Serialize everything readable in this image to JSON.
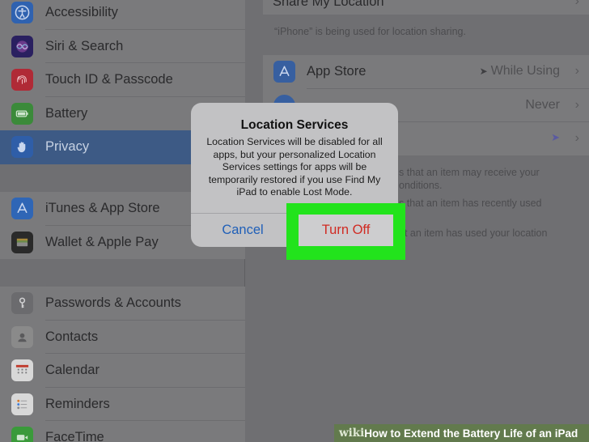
{
  "sidebar": {
    "group1": [
      {
        "label": "Accessibility",
        "icon": "accessibility-icon",
        "color": "#2f62b0"
      },
      {
        "label": "Siri & Search",
        "icon": "siri-icon",
        "color": "#2a2060"
      },
      {
        "label": "Touch ID & Passcode",
        "icon": "fingerprint-icon",
        "color": "#b02a36"
      },
      {
        "label": "Battery",
        "icon": "battery-icon",
        "color": "#3b8a3a"
      },
      {
        "label": "Privacy",
        "icon": "hand-icon",
        "color": "#2f5ea8"
      }
    ],
    "group2": [
      {
        "label": "iTunes & App Store",
        "icon": "app-store-icon",
        "color": "#2f66b6"
      },
      {
        "label": "Wallet & Apple Pay",
        "icon": "wallet-icon",
        "color": "#2a2a2a"
      }
    ],
    "group3": [
      {
        "label": "Passwords & Accounts",
        "icon": "key-icon",
        "color": "#6b6b6e"
      },
      {
        "label": "Contacts",
        "icon": "contacts-icon",
        "color": "#8a8a8a"
      },
      {
        "label": "Calendar",
        "icon": "calendar-icon",
        "color": "#d8d8d8"
      },
      {
        "label": "Reminders",
        "icon": "reminders-icon",
        "color": "#d8d8d8"
      },
      {
        "label": "FaceTime",
        "icon": "facetime-icon",
        "color": "#3a9a3a"
      }
    ],
    "selected": "Privacy"
  },
  "detail": {
    "share_location_label": "Share My Location",
    "share_note": "“iPhone” is being used for location sharing.",
    "apps": [
      {
        "label": "App Store",
        "value": "While Using",
        "icon": "app-store-icon",
        "has_arrow": true
      },
      {
        "label": "",
        "value": "Never",
        "icon": "safari-icon",
        "has_arrow": false
      },
      {
        "label": "",
        "value": "",
        "icon": "system-services-icon",
        "has_arrow": true
      }
    ],
    "notes": [
      "s that an item may receive your",
      "onditions.",
      "s that an item has recently used",
      "at an item has used your location"
    ]
  },
  "alert": {
    "title": "Location Services",
    "message": "Location Services will be disabled for all apps, but your personalized Location Services settings for apps will be temporarily restored if you use Find My iPad to enable Lost Mode.",
    "cancel_label": "Cancel",
    "turn_off_label": "Turn Off"
  },
  "watermark": {
    "brand": "wiki",
    "how": "How",
    "text": " to Extend the Battery Life of an iPad"
  },
  "colors": {
    "highlight": "#22e31c",
    "destructive": "#d02a22",
    "link": "#1f5fb8",
    "selected_row": "#3d5a85"
  }
}
